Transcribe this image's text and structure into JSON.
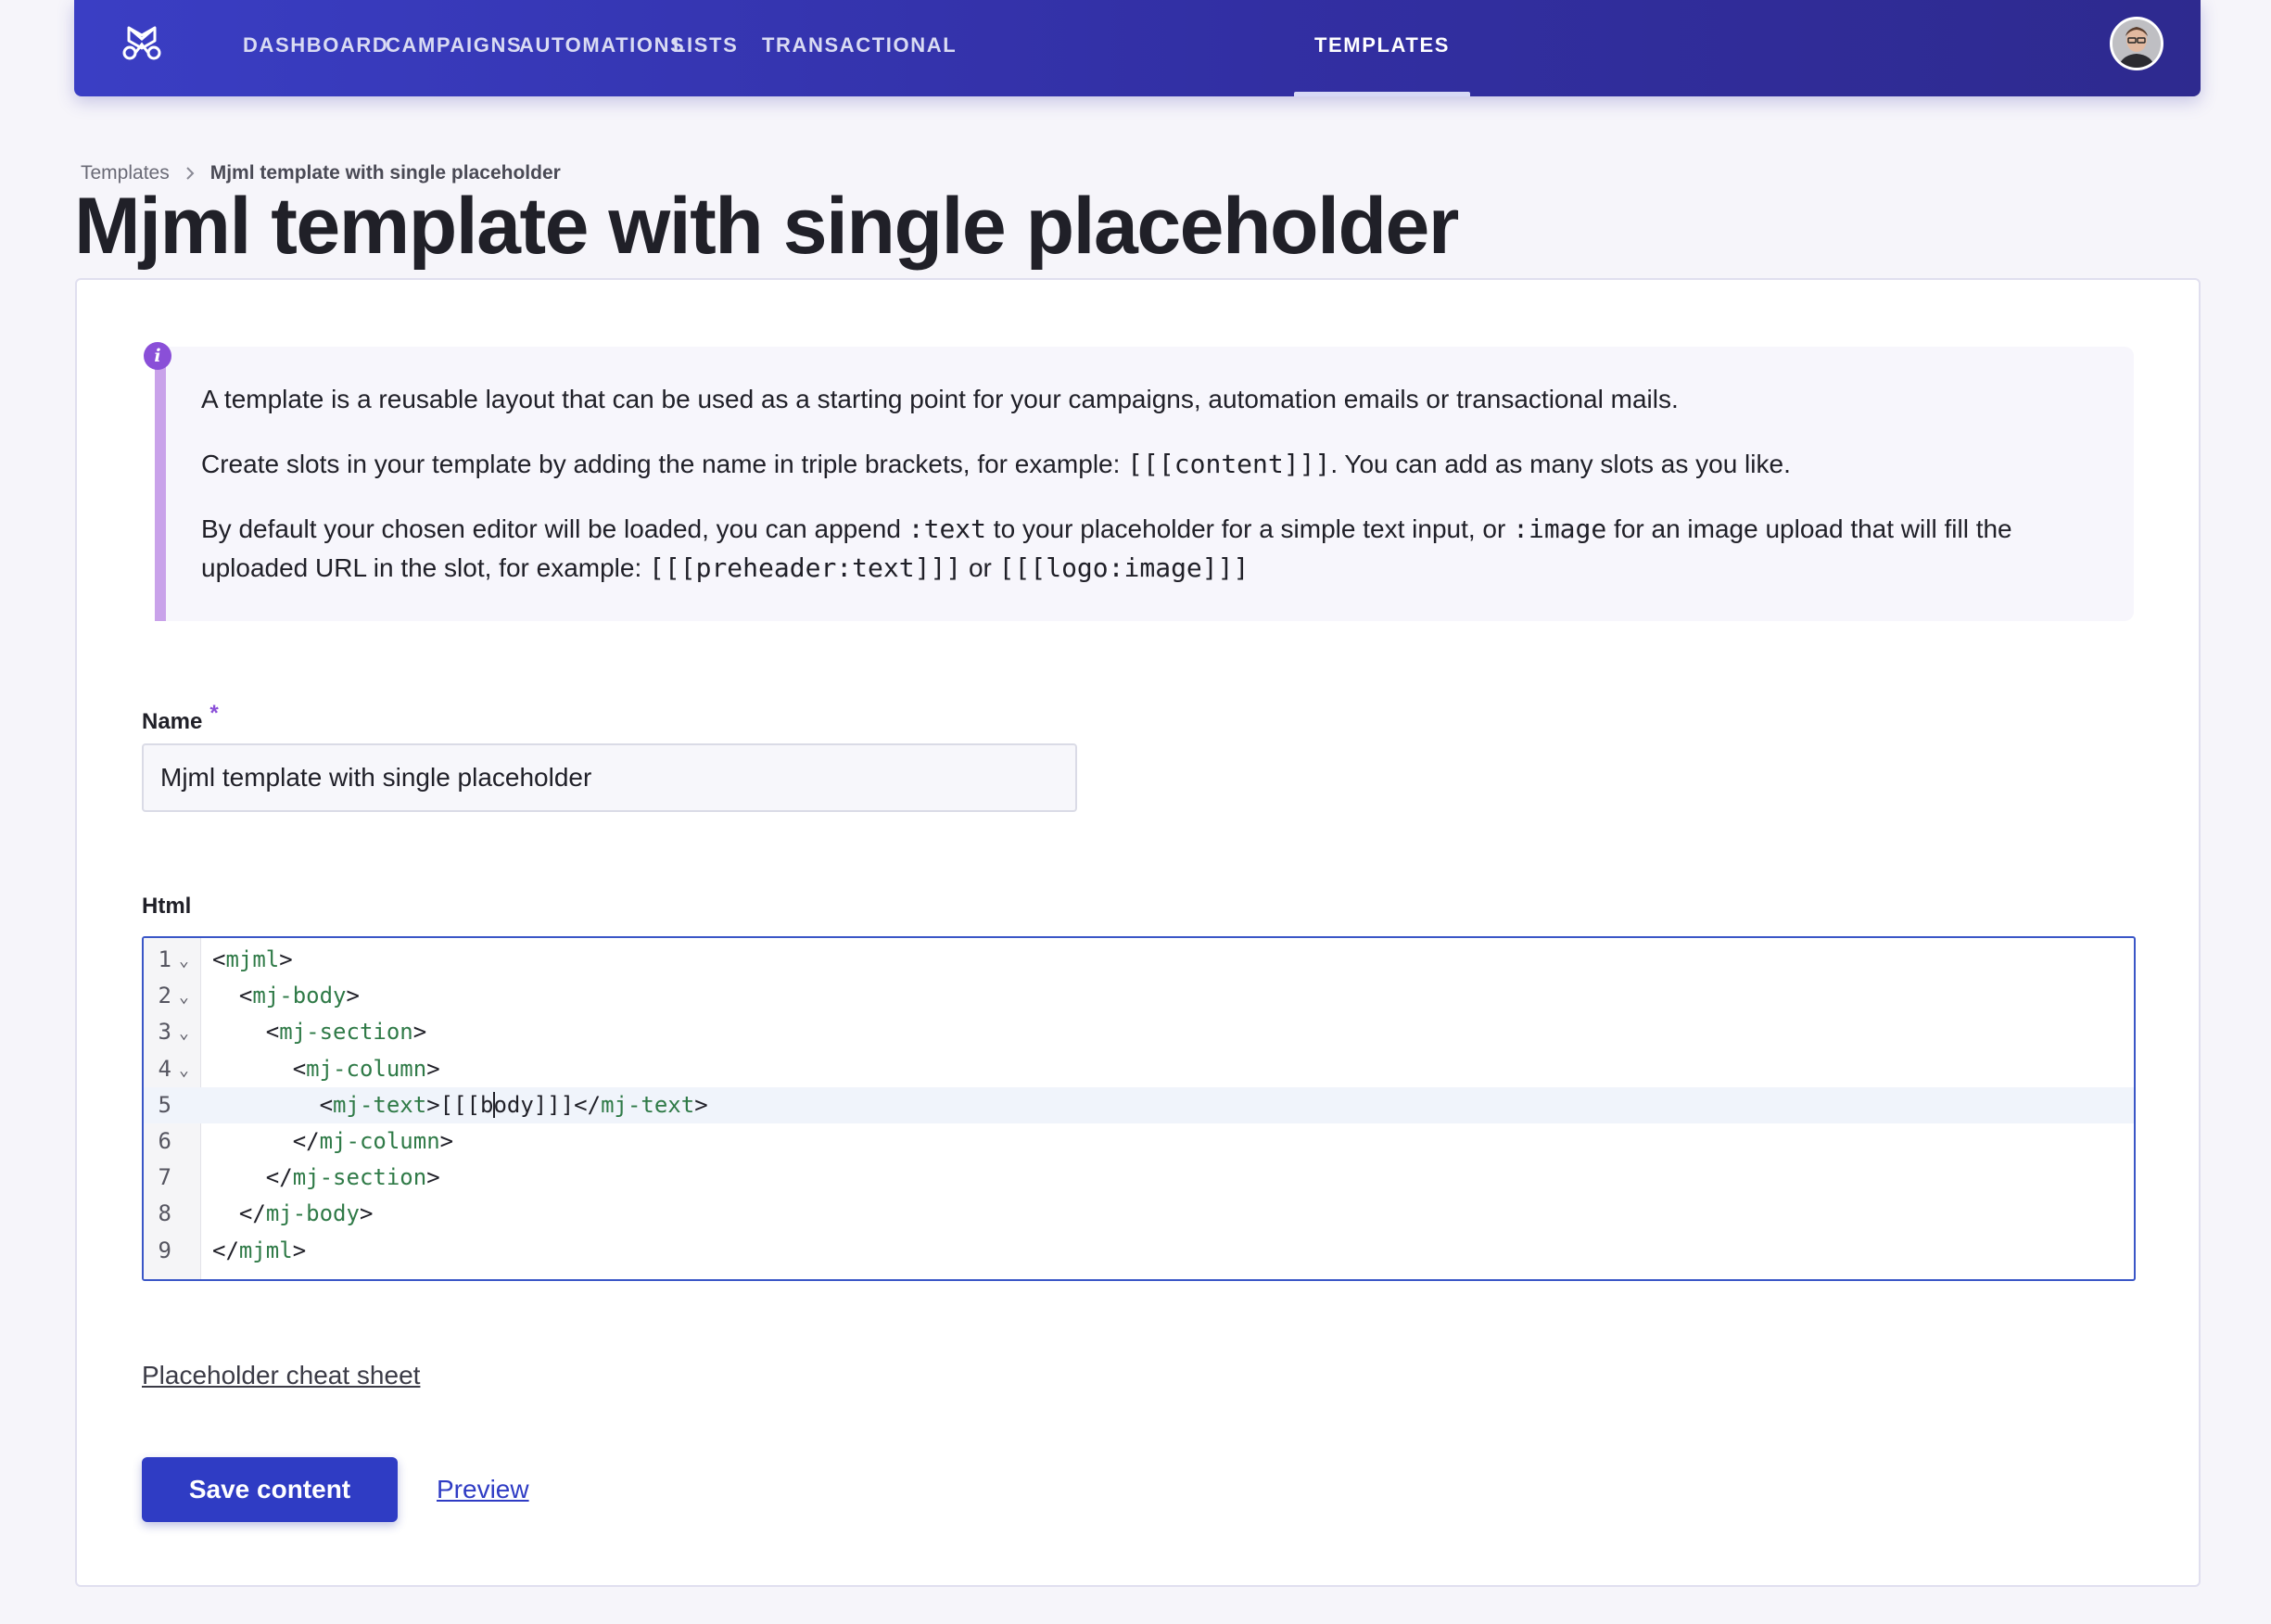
{
  "nav": {
    "items": [
      "DASHBOARD",
      "CAMPAIGNS",
      "AUTOMATIONS",
      "LISTS",
      "TRANSACTIONAL",
      "TEMPLATES"
    ],
    "active": "TEMPLATES"
  },
  "breadcrumb": {
    "parent": "Templates",
    "current": "Mjml template with single placeholder"
  },
  "page": {
    "title": "Mjml template with single placeholder"
  },
  "info": {
    "p1": "A template is a reusable layout that can be used as a starting point for your campaigns, automation emails or transactional mails.",
    "p2_before": "Create slots in your template by adding the name in triple brackets, for example: ",
    "p2_code": "[[[content]]]",
    "p2_after": ". You can add as many slots as you like.",
    "p3_a": "By default your chosen editor will be loaded, you can append ",
    "p3_code1": ":text",
    "p3_b": " to your placeholder for a simple text input, or ",
    "p3_code2": ":image",
    "p3_c": " for an image upload that will fill the uploaded URL in the slot, for example: ",
    "p3_code3": "[[[preheader:text]]]",
    "p3_d": " or ",
    "p3_code4": "[[[logo:image]]]"
  },
  "form": {
    "name_label": "Name",
    "required_marker": "*",
    "name_value": "Mjml template with single placeholder",
    "html_label": "Html"
  },
  "editor": {
    "lines": [
      {
        "n": "1",
        "indent": "",
        "open": "<",
        "tag": "mjml",
        "close": ">",
        "fold": true
      },
      {
        "n": "2",
        "indent": "  ",
        "open": "<",
        "tag": "mj-body",
        "close": ">",
        "fold": true
      },
      {
        "n": "3",
        "indent": "    ",
        "open": "<",
        "tag": "mj-section",
        "close": ">",
        "fold": true
      },
      {
        "n": "4",
        "indent": "      ",
        "open": "<",
        "tag": "mj-column",
        "close": ">",
        "fold": true
      },
      {
        "n": "5",
        "indent": "        ",
        "open": "<",
        "tag": "mj-text",
        "close": ">",
        "fold": false
      },
      {
        "n": "6",
        "indent": "      ",
        "open": "</",
        "tag": "mj-column",
        "close": ">",
        "fold": false
      },
      {
        "n": "7",
        "indent": "    ",
        "open": "</",
        "tag": "mj-section",
        "close": ">",
        "fold": false
      },
      {
        "n": "8",
        "indent": "  ",
        "open": "</",
        "tag": "mj-body",
        "close": ">",
        "fold": false
      },
      {
        "n": "9",
        "indent": "",
        "open": "</",
        "tag": "mjml",
        "close": ">",
        "fold": false
      }
    ],
    "line5_content_before_cursor": "[[[b",
    "line5_content_after_cursor": "ody]]]",
    "line5_end_open": "</",
    "line5_end_tag": "mj-text",
    "line5_end_close": ">",
    "active_line": "5"
  },
  "links": {
    "cheat_sheet": "Placeholder cheat sheet",
    "preview": "Preview"
  },
  "actions": {
    "save": "Save content"
  },
  "colors": {
    "brand": "#2f3cc4",
    "accent": "#8a4fd8",
    "tag": "#2f7a47"
  }
}
